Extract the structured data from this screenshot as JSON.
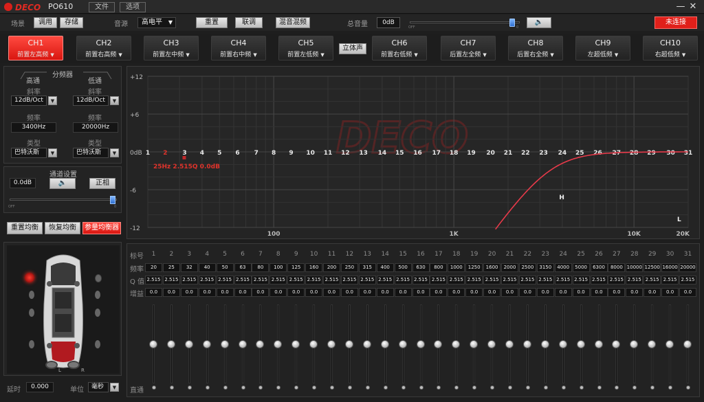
{
  "title": {
    "brand": "DECO",
    "name": "PO610",
    "file": "文件",
    "options": "选项",
    "minimize": "—",
    "close": "✕"
  },
  "toolbar": {
    "scene_label": "场景",
    "call": "调用",
    "save": "存储",
    "source_label": "音源",
    "source_value": "高电平",
    "reset": "重置",
    "link": "联调",
    "mix": "混音混频",
    "master_label": "总音量",
    "master_value": "0dB",
    "slider_min": "OFF",
    "slider_max": "0",
    "master_volume": 0.95,
    "connect": "未连接"
  },
  "channels": [
    {
      "name": "CH1",
      "sub": "前置左高频",
      "active": true
    },
    {
      "name": "CH2",
      "sub": "前置右高频",
      "active": false
    },
    {
      "name": "CH3",
      "sub": "前置左中频",
      "active": false
    },
    {
      "name": "CH4",
      "sub": "前置右中频",
      "active": false
    },
    {
      "name": "CH5",
      "sub": "前置左低频",
      "active": false
    },
    {
      "name": "CH6",
      "sub": "前置右低频",
      "active": false
    },
    {
      "name": "CH7",
      "sub": "后置左全频",
      "active": false
    },
    {
      "name": "CH8",
      "sub": "后置右全频",
      "active": false
    },
    {
      "name": "CH9",
      "sub": "左超低频",
      "active": false
    },
    {
      "name": "CH10",
      "sub": "右超低频",
      "active": false
    }
  ],
  "stereo": "立体声",
  "crossover": {
    "title": "分频器",
    "hp_label": "高通",
    "lp_label": "低通",
    "slope_label": "斜率",
    "hp_slope": "12dB/Oct",
    "lp_slope": "12dB/Oct",
    "freq_label": "频率",
    "hp_freq": "3400Hz",
    "lp_freq": "20000Hz",
    "type_label": "类型",
    "hp_type": "巴特沃斯",
    "lp_type": "巴特沃斯"
  },
  "channel_settings": {
    "title": "通道设置",
    "gain": "0.0dB",
    "phase": "正相",
    "slider_min": "OFF",
    "slider_max": "0",
    "channel_volume": 0.98
  },
  "eq_buttons": {
    "reset": "重置均衡",
    "restore": "恢复均衡",
    "param": "参量均衡器"
  },
  "delay": {
    "label": "延时",
    "value": "0.000",
    "unit_label": "单位",
    "unit_value": "毫秒"
  },
  "speaker_labels": {
    "left": "L",
    "right": "R"
  },
  "graph": {
    "y_ticks": [
      "+12",
      "+6",
      "0dB",
      "-6",
      "-12"
    ],
    "x_ticks": [
      "100",
      "1K",
      "10K",
      "20K"
    ],
    "band_markers": [
      "1",
      "2",
      "3",
      "4",
      "5",
      "6",
      "7",
      "8",
      "9",
      "10",
      "11",
      "12",
      "13",
      "14",
      "15",
      "16",
      "17",
      "18",
      "19",
      "20",
      "21",
      "22",
      "23",
      "24",
      "25",
      "26",
      "27",
      "28",
      "29",
      "30",
      "31"
    ],
    "band_readout": "25Hz 2.515Q 0.0dB",
    "hp_marker": "H",
    "lp_marker": "L",
    "watermark": "DECO"
  },
  "eq_table": {
    "row_index": "标号",
    "row_freq": "频率",
    "row_q": "Q 值",
    "row_gain": "增益",
    "row_bypass": "直通",
    "bands": [
      {
        "n": "1",
        "f": "20",
        "q": "2.515",
        "g": "0.0"
      },
      {
        "n": "2",
        "f": "25",
        "q": "2.515",
        "g": "0.0"
      },
      {
        "n": "3",
        "f": "32",
        "q": "2.515",
        "g": "0.0"
      },
      {
        "n": "4",
        "f": "40",
        "q": "2.515",
        "g": "0.0"
      },
      {
        "n": "5",
        "f": "50",
        "q": "2.515",
        "g": "0.0"
      },
      {
        "n": "6",
        "f": "63",
        "q": "2.515",
        "g": "0.0"
      },
      {
        "n": "7",
        "f": "80",
        "q": "2.515",
        "g": "0.0"
      },
      {
        "n": "8",
        "f": "100",
        "q": "2.515",
        "g": "0.0"
      },
      {
        "n": "9",
        "f": "125",
        "q": "2.515",
        "g": "0.0"
      },
      {
        "n": "10",
        "f": "160",
        "q": "2.515",
        "g": "0.0"
      },
      {
        "n": "11",
        "f": "200",
        "q": "2.515",
        "g": "0.0"
      },
      {
        "n": "12",
        "f": "250",
        "q": "2.515",
        "g": "0.0"
      },
      {
        "n": "13",
        "f": "315",
        "q": "2.515",
        "g": "0.0"
      },
      {
        "n": "14",
        "f": "400",
        "q": "2.515",
        "g": "0.0"
      },
      {
        "n": "15",
        "f": "500",
        "q": "2.515",
        "g": "0.0"
      },
      {
        "n": "16",
        "f": "630",
        "q": "2.515",
        "g": "0.0"
      },
      {
        "n": "17",
        "f": "800",
        "q": "2.515",
        "g": "0.0"
      },
      {
        "n": "18",
        "f": "1000",
        "q": "2.515",
        "g": "0.0"
      },
      {
        "n": "19",
        "f": "1250",
        "q": "2.515",
        "g": "0.0"
      },
      {
        "n": "20",
        "f": "1600",
        "q": "2.515",
        "g": "0.0"
      },
      {
        "n": "21",
        "f": "2000",
        "q": "2.515",
        "g": "0.0"
      },
      {
        "n": "22",
        "f": "2500",
        "q": "2.515",
        "g": "0.0"
      },
      {
        "n": "23",
        "f": "3150",
        "q": "2.515",
        "g": "0.0"
      },
      {
        "n": "24",
        "f": "4000",
        "q": "2.515",
        "g": "0.0"
      },
      {
        "n": "25",
        "f": "5000",
        "q": "2.515",
        "g": "0.0"
      },
      {
        "n": "26",
        "f": "6300",
        "q": "2.515",
        "g": "0.0"
      },
      {
        "n": "27",
        "f": "8000",
        "q": "2.515",
        "g": "0.0"
      },
      {
        "n": "28",
        "f": "10000",
        "q": "2.515",
        "g": "0.0"
      },
      {
        "n": "29",
        "f": "12500",
        "q": "2.515",
        "g": "0.0"
      },
      {
        "n": "30",
        "f": "16000",
        "q": "2.515",
        "g": "0.0"
      },
      {
        "n": "31",
        "f": "20000",
        "q": "2.515",
        "g": "0.0"
      }
    ]
  },
  "colors": {
    "accent": "#e0201a",
    "curve": "#e83a4a",
    "background": "#1e1e1e"
  }
}
